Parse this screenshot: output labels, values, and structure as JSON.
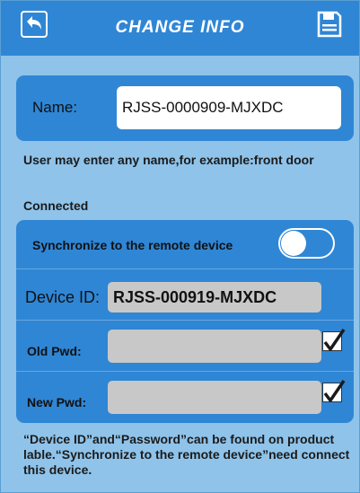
{
  "header": {
    "title": "CHANGE INFO",
    "back_icon": "back-arrow-icon",
    "save_icon": "floppy-disk-icon"
  },
  "name_field": {
    "label": "Name:",
    "value": "RJSS-0000909-MJXDC"
  },
  "hint": "User may enter any name,for example:front door",
  "status": "Connected",
  "sync": {
    "label": "Synchronize to the remote device",
    "enabled": false
  },
  "device_id": {
    "label": "Device  ID:",
    "value": "RJSS-000919-MJXDC"
  },
  "old_pwd": {
    "label": "Old Pwd:",
    "value": "",
    "show_checked": true
  },
  "new_pwd": {
    "label": "New Pwd:",
    "value": "",
    "show_checked": true
  },
  "footer_note": "“Device ID”and“Password”can be found on product lable.“Synchronize to the remote device”need connect this device.",
  "colors": {
    "header": "#2f86d5",
    "background": "#8fc3ea",
    "field_gray": "#c8c8c8"
  }
}
